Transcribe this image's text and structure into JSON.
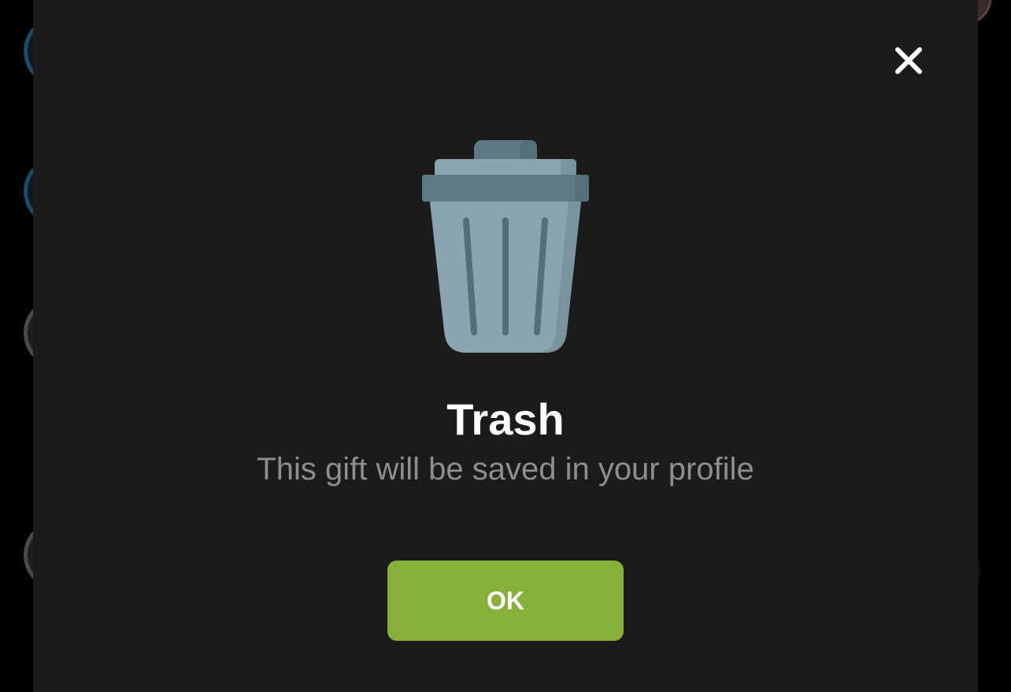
{
  "dialog": {
    "title": "Trash",
    "message": "This gift will be saved in your profile",
    "ok_label": "OK",
    "icon": "trash-can-icon",
    "close_icon": "close-icon"
  },
  "colors": {
    "modal_background": "#1b1b1b",
    "ok_button": "#86b03a",
    "title_text": "#ffffff",
    "message_text": "#8e8e8e",
    "trash_body": "#8ba5b0",
    "trash_dark": "#5f7a82"
  }
}
